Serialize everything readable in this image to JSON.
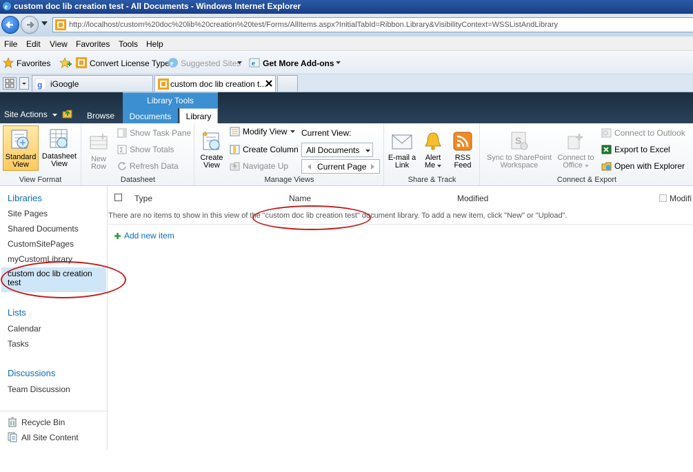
{
  "window": {
    "title": "custom doc lib creation test - All Documents - Windows Internet Explorer"
  },
  "address": {
    "url": "http://localhost/custom%20doc%20lib%20creation%20test/Forms/AllItems.aspx?InitialTabId=Ribbon.Library&VisibilityContext=WSSListAndLibrary"
  },
  "menu": [
    "File",
    "Edit",
    "View",
    "Favorites",
    "Tools",
    "Help"
  ],
  "favbar": {
    "favorites": "Favorites",
    "convert": "Convert License Type",
    "suggested": "Suggested Sites",
    "addons": "Get More Add-ons"
  },
  "tabs": {
    "igoogle": "iGoogle",
    "current": "custom doc lib creation t..."
  },
  "sp": {
    "site_actions": "Site Actions",
    "browse": "Browse",
    "library_tools": "Library Tools",
    "documents": "Documents",
    "library": "Library"
  },
  "ribbon": {
    "view_format": {
      "name": "View Format",
      "standard_1": "Standard",
      "standard_2": "View",
      "datasheet_1": "Datasheet",
      "datasheet_2": "View"
    },
    "datasheet": {
      "name": "Datasheet",
      "new_1": "New",
      "new_2": "Row",
      "task_pane": "Show Task Pane",
      "totals": "Show Totals",
      "refresh": "Refresh Data"
    },
    "manage_views": {
      "name": "Manage Views",
      "create_1": "Create",
      "create_2": "View",
      "modify": "Modify View",
      "create_col": "Create Column",
      "navigate_up": "Navigate Up",
      "current_view_label": "Current View:",
      "current_view_value": "All Documents",
      "current_page": "Current Page"
    },
    "share_track": {
      "name": "Share & Track",
      "email_1": "E-mail a",
      "email_2": "Link",
      "alert_1": "Alert",
      "alert_2": "Me",
      "rss_1": "RSS",
      "rss_2": "Feed"
    },
    "connect_export": {
      "name": "Connect & Export",
      "sync_1": "Sync to SharePoint",
      "sync_2": "Workspace",
      "office_1": "Connect to",
      "office_2": "Office",
      "outlook": "Connect to Outlook",
      "excel": "Export to Excel",
      "explorer": "Open with Explorer"
    }
  },
  "nav": {
    "libraries": "Libraries",
    "library_items": [
      "Site Pages",
      "Shared Documents",
      "CustomSitePages",
      "myCustomLibrary"
    ],
    "selected": "custom doc lib creation test",
    "lists": "Lists",
    "list_items": [
      "Calendar",
      "Tasks"
    ],
    "discussions": "Discussions",
    "discussion_items": [
      "Team Discussion"
    ],
    "recycle": "Recycle Bin",
    "all_content": "All Site Content"
  },
  "list": {
    "headers": {
      "type": "Type",
      "name": "Name",
      "modified": "Modified",
      "modified_by": "Modifi"
    },
    "empty_message": "There are no items to show in this view of the \"custom doc lib creation test\" document library. To add a new item, click \"New\" or \"Upload\".",
    "add_new": "Add new item"
  }
}
